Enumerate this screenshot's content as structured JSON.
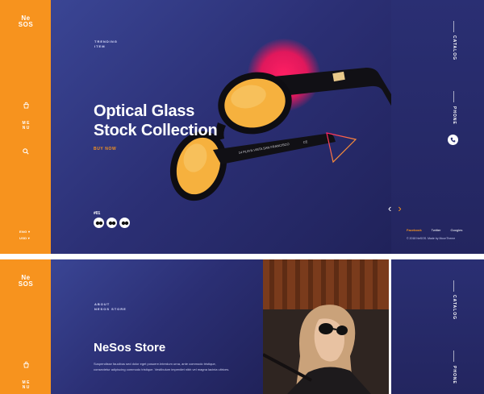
{
  "hero": {
    "logo_top": "Ne",
    "logo_bottom": "SOS",
    "menu_label": "M E N U",
    "lang_1": "ENG",
    "lang_2": "USD",
    "trending_line1": "TRENDING",
    "trending_line2": "ITEM",
    "headline_line1": "Optical Glass",
    "headline_line2": "Stock Collection",
    "buy_now": "BUY NOW",
    "counter": "#01",
    "glasses_arm_text": "14  PLAYA VISTA SAN FRANCISCO",
    "glasses_arm_code": "CE",
    "catalog": "CATALOG",
    "phone": "PHONE",
    "social": [
      "Facebook",
      "Twitter",
      "Googles"
    ],
    "copyright": "© 2018 NeSOS. Made by MoonTheme",
    "colors": {
      "accent": "#f7931e",
      "navy": "#2b2f74",
      "pink_glow": "#ff1f63",
      "lens": "#f6b13e"
    },
    "icons": [
      "bag-icon",
      "search-icon",
      "phone-icon",
      "arrow-left-icon",
      "arrow-right-icon"
    ]
  },
  "about": {
    "logo_top": "Ne",
    "logo_bottom": "SOS",
    "menu_label": "M E N U",
    "label_line1": "ABOUT",
    "label_line2": "NESOS STORE",
    "title": "NeSos Store",
    "text": "Suspendisse faucibus sed dolor eget posuere.Interdum urna, ante commodo tristique, consectetur adipiscing commodo tristique. Vestibulum imperdiet nibh vel magna lacinia ultrices.",
    "catalog": "CATALOG",
    "phone": "PHONE"
  }
}
